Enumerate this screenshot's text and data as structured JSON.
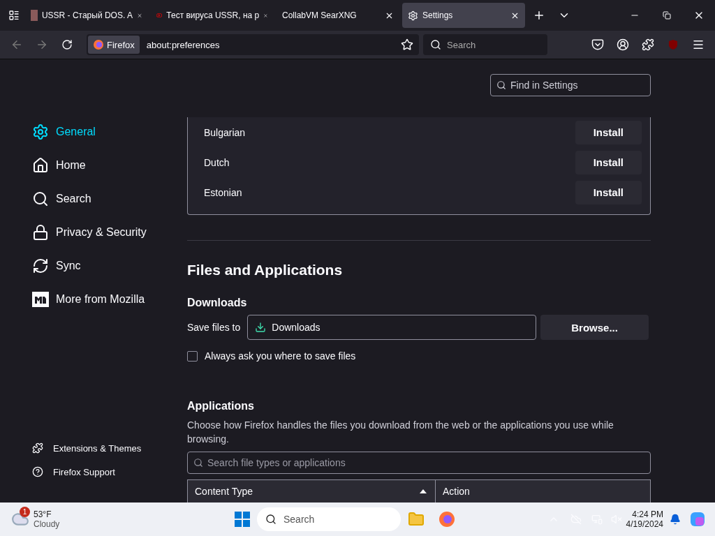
{
  "tabs": [
    {
      "title": "USSR - Старый DOS. A",
      "kind": "photo",
      "selected": false
    },
    {
      "title": "Тест вируса USSR, на р",
      "kind": "video",
      "selected": false
    },
    {
      "title": "CollabVM SearXNG",
      "kind": "none",
      "selected": false
    },
    {
      "title": "Settings",
      "kind": "gear",
      "selected": true
    }
  ],
  "urlbar": {
    "identity": "Firefox",
    "url": "about:preferences"
  },
  "search": {
    "placeholder": "Search"
  },
  "find": {
    "placeholder": "Find in Settings"
  },
  "sidebar": {
    "items": [
      {
        "label": "General",
        "selected": true
      },
      {
        "label": "Home",
        "selected": false
      },
      {
        "label": "Search",
        "selected": false
      },
      {
        "label": "Privacy & Security",
        "selected": false
      },
      {
        "label": "Sync",
        "selected": false
      },
      {
        "label": "More from Mozilla",
        "selected": false
      }
    ],
    "footer": [
      {
        "label": "Extensions & Themes"
      },
      {
        "label": "Firefox Support"
      }
    ]
  },
  "languages": [
    {
      "name": "Bulgarian",
      "button": "Install"
    },
    {
      "name": "Dutch",
      "button": "Install"
    },
    {
      "name": "Estonian",
      "button": "Install"
    }
  ],
  "section": {
    "title": "Files and Applications",
    "downloads_heading": "Downloads",
    "save_label": "Save files to",
    "folder": "Downloads",
    "browse": "Browse...",
    "always_ask": {
      "label": "Always ask you where to save files",
      "checked": false
    }
  },
  "applications": {
    "heading": "Applications",
    "description": "Choose how Firefox handles the files you download from the web or the applications you use while browsing.",
    "search_placeholder": "Search file types or applications",
    "columns": [
      "Content Type",
      "Action"
    ]
  },
  "taskbar": {
    "weather": {
      "badge": "1",
      "temp": "53°F",
      "condition": "Cloudy"
    },
    "search": "Search",
    "time": "4:24 PM",
    "date": "4/19/2024"
  }
}
